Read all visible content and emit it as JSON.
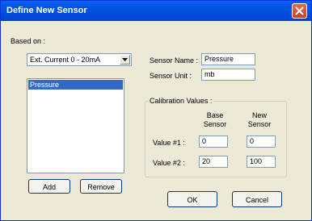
{
  "window": {
    "title": "Define New Sensor",
    "close_icon": "close-icon"
  },
  "based_on": {
    "label": "Based on :",
    "selected": "Ext. Current 0 - 20mA"
  },
  "sensor_list": {
    "items": [
      "Pressure"
    ]
  },
  "buttons": {
    "add": "Add",
    "remove": "Remove",
    "ok": "OK",
    "cancel": "Cancel"
  },
  "sensor": {
    "name_label": "Sensor Name :",
    "name_value": "Pressure",
    "unit_label": "Sensor Unit :",
    "unit_value": "mb"
  },
  "calibration": {
    "caption": "Calibration Values :",
    "base_header_1": "Base",
    "base_header_2": "Sensor",
    "new_header_1": "New",
    "new_header_2": "Sensor",
    "value1_label": "Value #1 :",
    "value2_label": "Value #2 :",
    "value1_base": "0",
    "value1_new": "0",
    "value2_base": "20",
    "value2_new": "100"
  },
  "colors": {
    "titlebar": "#0053e1",
    "selection": "#316ac5",
    "dialog_bg": "#ece9d8"
  }
}
